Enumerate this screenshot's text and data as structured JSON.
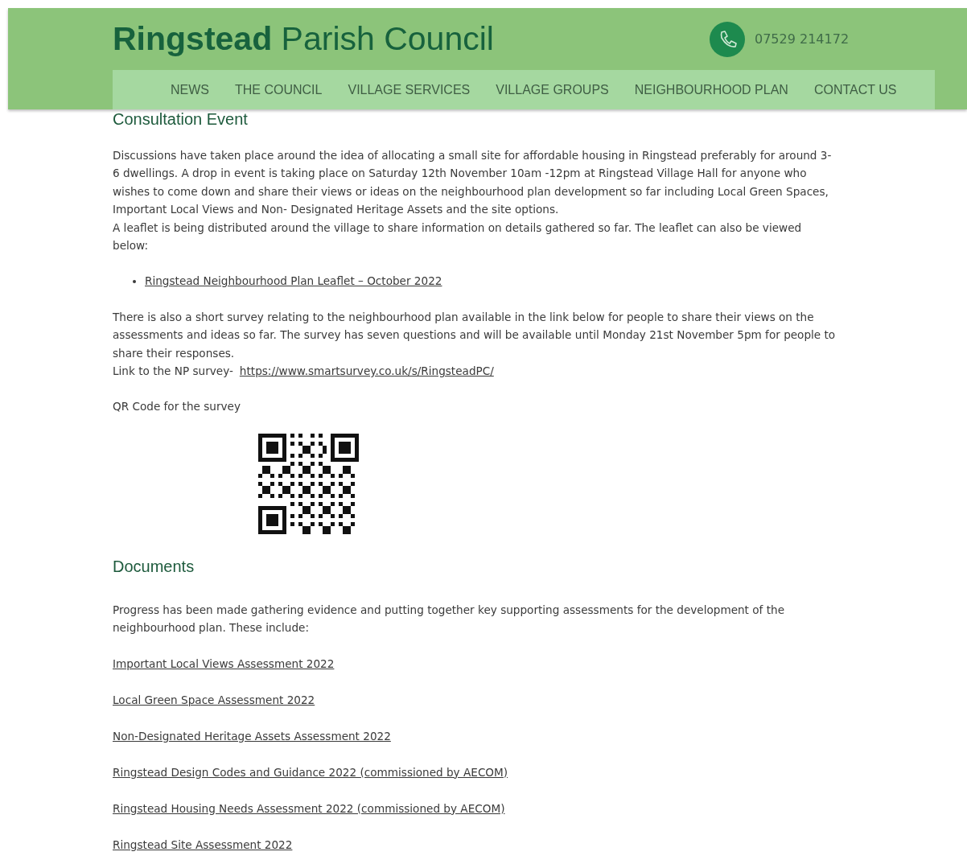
{
  "header": {
    "title": "**Ringstead** Parish Council",
    "phone": "07529 214172"
  },
  "nav": [
    {
      "label": "NEWS"
    },
    {
      "label": "THE COUNCIL"
    },
    {
      "label": "VILLAGE SERVICES"
    },
    {
      "label": "VILLAGE GROUPS"
    },
    {
      "label": "NEIGHBOURHOOD PLAN"
    },
    {
      "label": "CONTACT US"
    }
  ],
  "consultation": {
    "heading": "Consultation Event",
    "intro": [
      "Discussions have taken place around the idea of allocating a small site for affordable housing in Ringstead preferably for around 3-6 dwellings. A drop in event is taking place on Saturday 12th November 10am -12pm at Ringstead Village Hall for anyone who wishes to come down and share their views or ideas on the neighbourhood plan development so far including Local Green Spaces, Important Local Views and Non- Designated Heritage Assets and the site options.",
      "A leaflet is being distributed around the village to share information on details gathered so far. The leaflet can also be viewed below:"
    ],
    "bullets": [
      "Ringstead Neighbourhood Plan Leaflet – October 2022"
    ],
    "survey_text": "There is also a short survey relating to the neighbourhood plan available in the link below for people to share their views on the assessments and ideas so far. The survey has seven questions and will be available until Monday 21st November 5pm for people to share their responses.",
    "survey_label": "Link to the NP survey-",
    "survey_link": "https://www.smartsurvey.co.uk/s/RingsteadPC/",
    "qr_label": "QR Code for the survey"
  },
  "documents": {
    "heading": "Documents",
    "intro": "Progress has been made gathering evidence and putting together key supporting assessments for the development of the neighbourhood plan. These include:",
    "links": [
      "Important Local Views Assessment 2022",
      "Local Green Space Assessment 2022",
      "Non-Designated Heritage Assets Assessment 2022",
      "Ringstead Design Codes and Guidance  2022 (commissioned by AECOM)",
      "Ringstead Housing Needs Assessment 2022 (commissioned by AECOM)",
      "Ringstead Site Assessment 2022"
    ]
  }
}
